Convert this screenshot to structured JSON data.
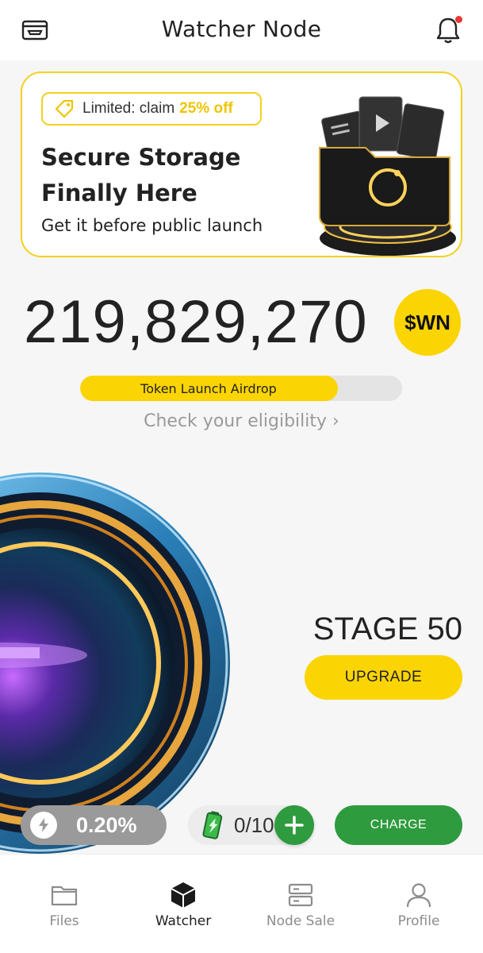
{
  "header": {
    "title": "Watcher Node",
    "left_icon": "wallet-icon",
    "right_icon": "bell-icon",
    "has_notification": true
  },
  "promo": {
    "badge_prefix": "Limited: claim",
    "badge_highlight": "25% off",
    "title_line1": "Secure Storage",
    "title_line2": "Finally Here",
    "subtitle": "Get it before public launch",
    "art_icon": "folder-files-illustration"
  },
  "balance": {
    "amount": "219,829,270",
    "token": "$WN"
  },
  "airdrop": {
    "label": "Token Launch Airdrop",
    "progress_fraction": 0.8,
    "eligibility_text": "Check your eligibility"
  },
  "stage": {
    "label": "STAGE 50",
    "upgrade_label": "UPGRADE"
  },
  "controls": {
    "rate": "0.20%",
    "battery": "0/10",
    "charge_label": "CHARGE"
  },
  "colors": {
    "accent_yellow": "#fbd404",
    "accent_green": "#2e9b3e",
    "muted_gray": "#9a9a9a"
  },
  "nav": {
    "items": [
      {
        "label": "Files",
        "icon": "folder-icon"
      },
      {
        "label": "Watcher",
        "icon": "cube-icon"
      },
      {
        "label": "Node Sale",
        "icon": "server-icon"
      },
      {
        "label": "Profile",
        "icon": "user-icon"
      }
    ],
    "active": "Watcher"
  }
}
